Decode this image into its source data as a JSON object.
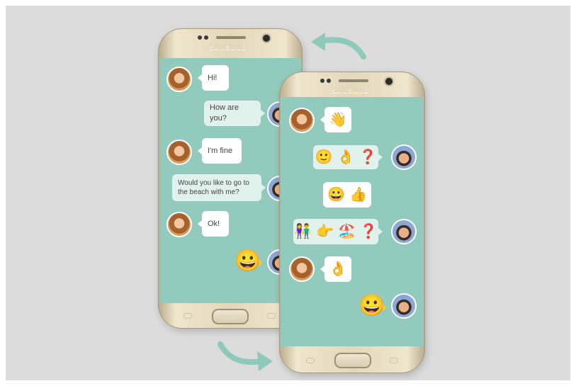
{
  "brand": "SAMSUNG",
  "colors": {
    "screen": "#92cbbd",
    "bubble": "#ffffff",
    "arrow": "#8fc9ba",
    "gold": "#e4d8ba"
  },
  "back_phone": {
    "messages": [
      {
        "side": "left",
        "text": "Hi!"
      },
      {
        "side": "right",
        "text": "How are you?"
      },
      {
        "side": "left",
        "text": "I'm fine"
      },
      {
        "side": "right",
        "text": "Would you like to go to the beach with me?"
      },
      {
        "side": "left",
        "text": "Ok!"
      },
      {
        "side": "right",
        "emoji": "😀"
      }
    ]
  },
  "front_phone": {
    "messages": [
      {
        "side": "left",
        "emoji": [
          "👋"
        ]
      },
      {
        "side": "right",
        "emoji": [
          "🙂",
          "👌",
          "❓"
        ]
      },
      {
        "side": "center",
        "emoji": [
          "😀",
          "👍"
        ]
      },
      {
        "side": "right",
        "emoji": [
          "👫",
          "👉",
          "🏖️",
          "❓"
        ]
      },
      {
        "side": "left",
        "emoji": [
          "👌"
        ]
      },
      {
        "side": "right",
        "emoji": [
          "😀"
        ]
      }
    ]
  },
  "icons": [
    "woman-avatar",
    "man-avatar",
    "curved-arrow-icon"
  ]
}
